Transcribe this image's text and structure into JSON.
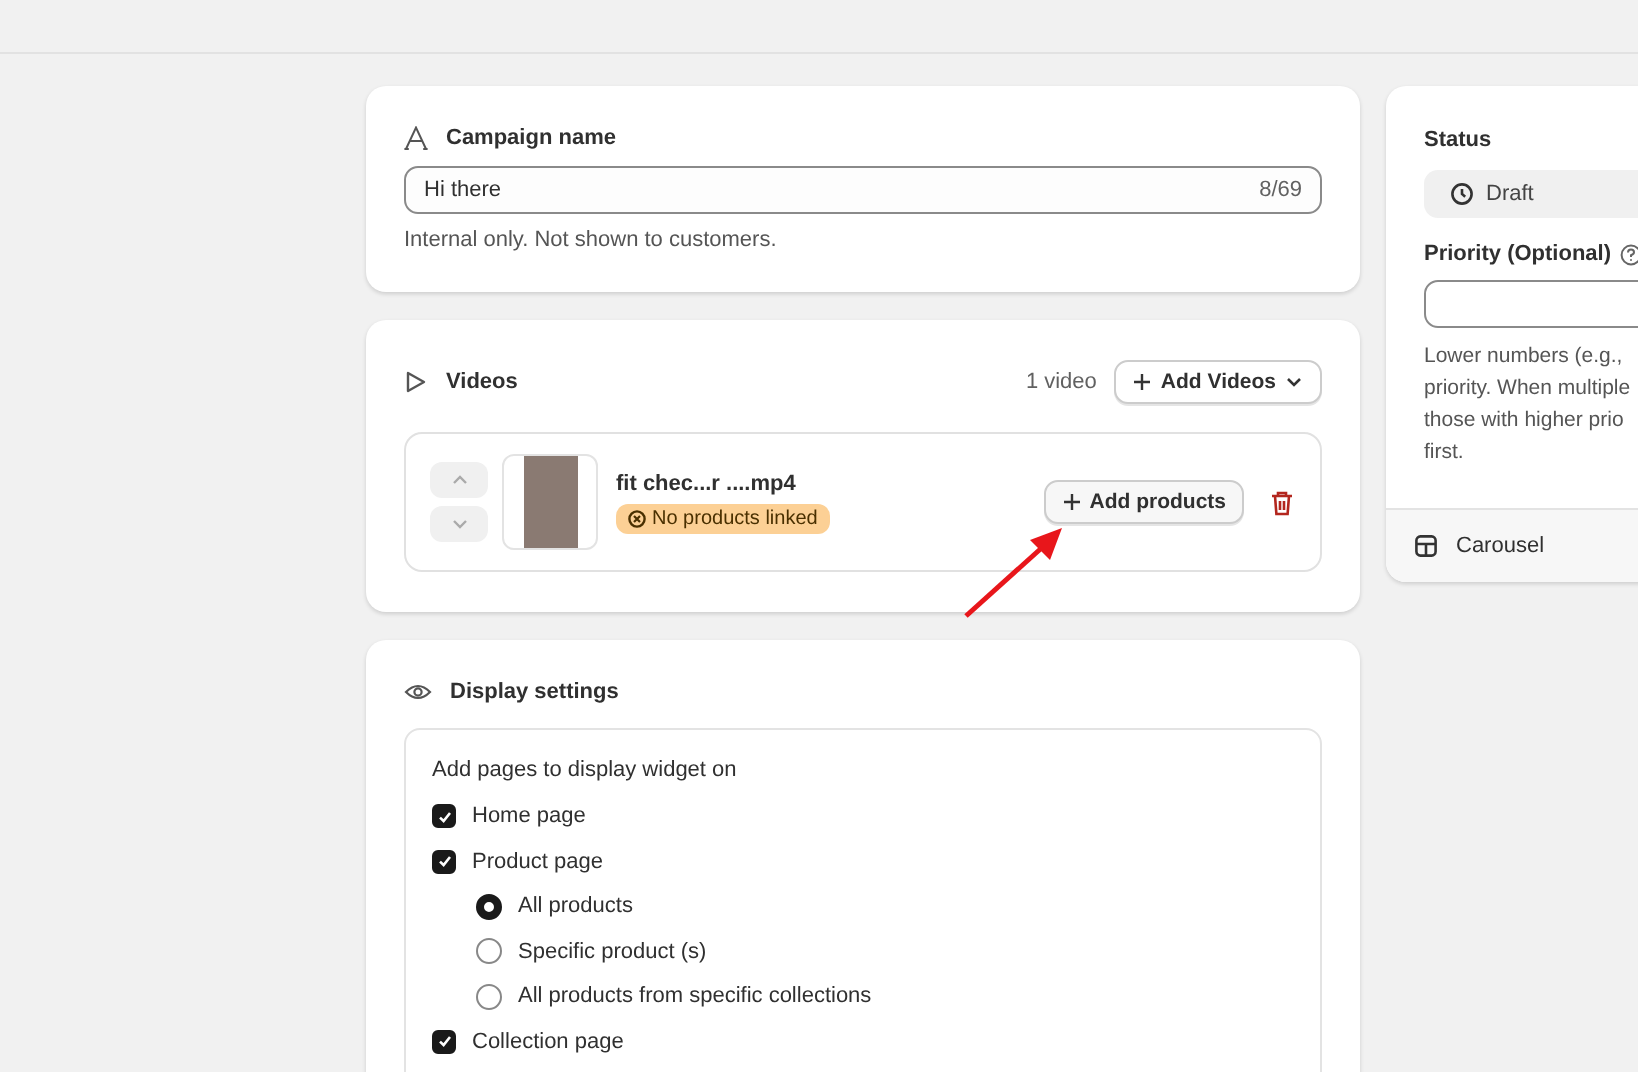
{
  "campaign": {
    "title": "Campaign name",
    "value": "Hi there",
    "counter": "8/69",
    "help": "Internal only. Not shown to customers."
  },
  "videos": {
    "title": "Videos",
    "count": "1 video",
    "add_button": "Add Videos",
    "items": [
      {
        "name": "fit chec...r ....mp4",
        "badge": "No products linked",
        "add_button": "Add products"
      }
    ]
  },
  "display": {
    "title": "Display settings",
    "prompt": "Add pages to display widget on",
    "options": [
      {
        "kind": "checkbox",
        "label": "Home page",
        "checked": true
      },
      {
        "kind": "checkbox",
        "label": "Product page",
        "checked": true
      },
      {
        "kind": "radio",
        "label": "All products",
        "selected": true
      },
      {
        "kind": "radio",
        "label": "Specific product (s)",
        "selected": false
      },
      {
        "kind": "radio",
        "label": "All products from specific collections",
        "selected": false
      },
      {
        "kind": "checkbox",
        "label": "Collection page",
        "checked": true
      }
    ]
  },
  "sidebar": {
    "status_label": "Status",
    "status": "Draft",
    "priority_label": "Priority (Optional)",
    "priority_help": [
      "Lower numbers (e.g.,",
      "priority. When multiple",
      "those with higher prio",
      "first."
    ],
    "layout": "Carousel"
  }
}
